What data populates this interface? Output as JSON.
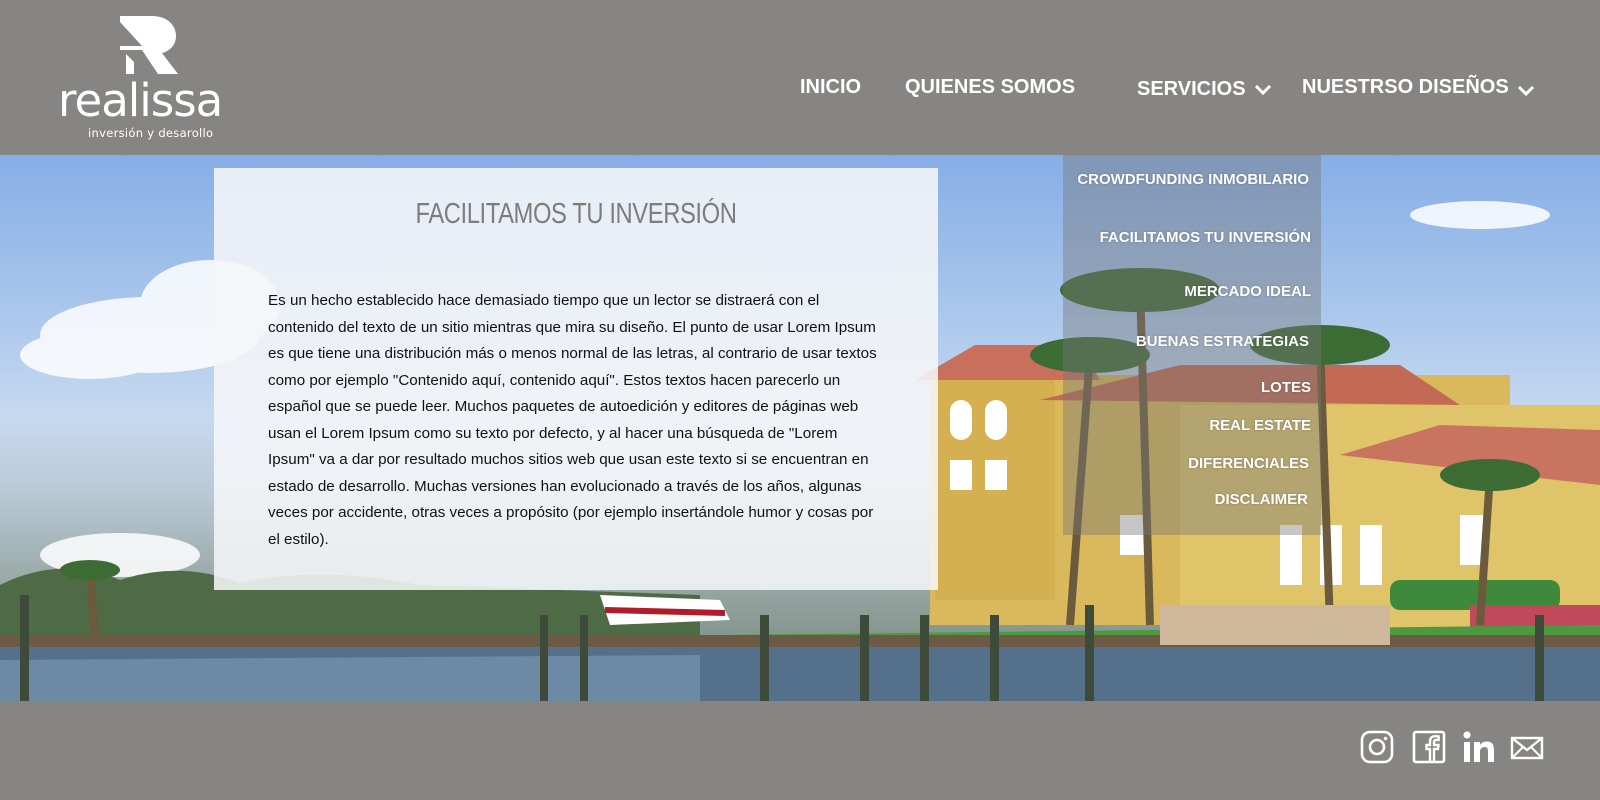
{
  "brand": {
    "name": "realissa",
    "tagline": "inversión y desarollo",
    "logo_icon": "r-logo-icon"
  },
  "nav": {
    "items": [
      {
        "label": "INICIO",
        "has_dropdown": false
      },
      {
        "label": "QUIENES SOMOS",
        "has_dropdown": false
      },
      {
        "label": "SERVICIOS",
        "has_dropdown": true
      },
      {
        "label": "NUESTRSO DISEÑOS",
        "has_dropdown": true
      }
    ]
  },
  "dropdown": {
    "items": [
      "CROWDFUNDING INMOBILARIO",
      "FACILITAMOS TU INVERSIÓN",
      "MERCADO IDEAL",
      "BUENAS ESTRATEGIAS",
      "LOTES",
      "REAL ESTATE",
      "DIFERENCIALES",
      "DISCLAIMER"
    ]
  },
  "main": {
    "title": "FACILITAMOS TU INVERSIÓN",
    "body": "Es un hecho establecido hace demasiado tiempo que un lector se distraerá con el contenido del texto de un sitio mientras que mira su diseño. El punto de usar Lorem Ipsum es que tiene una distribución más o menos normal de las letras, al contrario de usar textos como por ejemplo \"Contenido aquí, contenido aquí\". Estos textos hacen parecerlo un español que se puede leer. Muchos paquetes de autoedición y editores de páginas web usan el Lorem Ipsum como su texto por defecto, y al hacer una búsqueda de \"Lorem Ipsum\" va a dar por resultado muchos sitios web que usan este texto si se encuentran en estado de desarrollo. Muchas versiones han evolucionado a través de los años, algunas veces por accidente, otras veces a propósito (por ejemplo insertándole humor y cosas por el estilo)."
  },
  "footer": {
    "social_icons": [
      "instagram-icon",
      "facebook-icon",
      "linkedin-icon",
      "mail-icon"
    ]
  },
  "colors": {
    "header_bg": "#868583",
    "text_white": "#ffffff",
    "title_gray": "#7d7d7d"
  }
}
